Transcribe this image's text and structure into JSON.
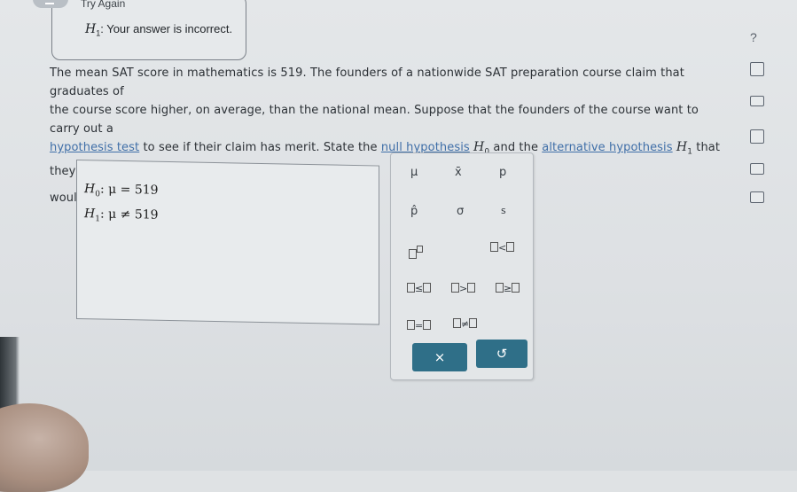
{
  "feedback": {
    "title": "Try Again",
    "hypothesis_symbol": "H",
    "hypothesis_sub": "1",
    "message": ": Your answer is incorrect."
  },
  "help_label": "?",
  "question": {
    "sentence1": "The mean SAT score in mathematics is 519. The founders of a nationwide SAT preparation course claim that graduates of",
    "sentence2": "the course score higher, on average, than the national mean. Suppose that the founders of the course want to carry out a",
    "link_hypothesis_test": "hypothesis test",
    "sentence3a": " to see if their claim has merit. State the ",
    "link_null": "null hypothesis",
    "null_symbol": "H",
    "null_sub": "0",
    "sentence3b": " and the ",
    "link_alt": "alternative hypothesis",
    "alt_symbol": "H",
    "alt_sub": "1",
    "sentence3c": " that they",
    "sentence4": "would use."
  },
  "answer": {
    "h0_symbol": "H",
    "h0_sub": "0",
    "h0_expr": ": μ = 519",
    "h1_symbol": "H",
    "h1_sub": "1",
    "h1_expr": ": μ ≠ 519"
  },
  "keypad": {
    "mu": "μ",
    "xbar": "x̄",
    "p": "p",
    "phat": "p̂",
    "sigma": "σ",
    "s": "s",
    "lt": "<",
    "le": "≤",
    "gt": ">",
    "ge": "≥",
    "eq": "=",
    "ne": "≠",
    "clear": "×",
    "undo": "↺"
  }
}
